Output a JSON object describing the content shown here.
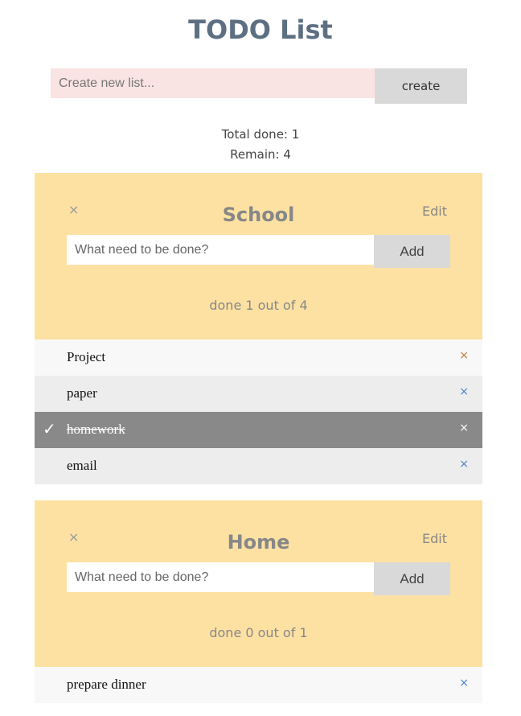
{
  "title": "TODO List",
  "new_list": {
    "placeholder": "Create new list...",
    "button": "create"
  },
  "stats": {
    "total_done": "Total done: 1",
    "remain": "Remain: 4"
  },
  "lists": [
    {
      "name": "School",
      "edit": "Edit",
      "delete": "×",
      "input_placeholder": "What need to be done?",
      "add": "Add",
      "count": "done 1 out of 4",
      "items": [
        {
          "text": "Project",
          "done": false,
          "x": "×"
        },
        {
          "text": "paper",
          "done": false,
          "x": "×"
        },
        {
          "text": "homework",
          "done": true,
          "x": "×",
          "check": "✓"
        },
        {
          "text": "email",
          "done": false,
          "x": "×"
        }
      ]
    },
    {
      "name": "Home",
      "edit": "Edit",
      "delete": "×",
      "input_placeholder": "What need to be done?",
      "add": "Add",
      "count": "done 0 out of 1",
      "items": [
        {
          "text": "prepare dinner",
          "done": false,
          "x": "×"
        }
      ]
    }
  ],
  "colors": {
    "card": "#fde1a3",
    "done_row": "#898989",
    "new_list_input": "#f9e3e3"
  }
}
